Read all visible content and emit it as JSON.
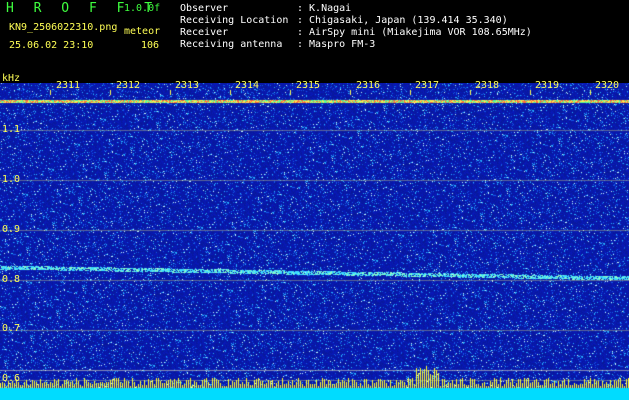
{
  "header": {
    "app_name": "H R O F F T",
    "version": "1.0.0f",
    "filename": "KN9_2506022310.png",
    "mode": "meteor",
    "datetime": "25.06.02 23:10",
    "count": "106"
  },
  "meta": [
    {
      "label": "Observer",
      "value": ": K.Nagai"
    },
    {
      "label": "Receiving Location",
      "value": ": Chigasaki, Japan (139.414 35.340)"
    },
    {
      "label": "Receiver",
      "value": ": AirSpy mini (Miakejima VOR 108.65MHz)"
    },
    {
      "label": "Receiving antenna",
      "value": ": Maspro FM-3"
    }
  ],
  "axis": {
    "unit_label": "kHz",
    "y_ticks": [
      "1.1",
      "1.0",
      "0.9",
      "0.8",
      "0.7",
      "0.6"
    ],
    "x_ticks": [
      "2311",
      "2312",
      "2313",
      "2314",
      "2315",
      "2316",
      "2317",
      "2318",
      "2319",
      "2320"
    ]
  },
  "colors": {
    "background": "#000000",
    "noise_base": "#0a1fb0",
    "grid": "#ffff55",
    "signal": "#5fff9f",
    "bottom_band": "#00e5ff"
  }
}
